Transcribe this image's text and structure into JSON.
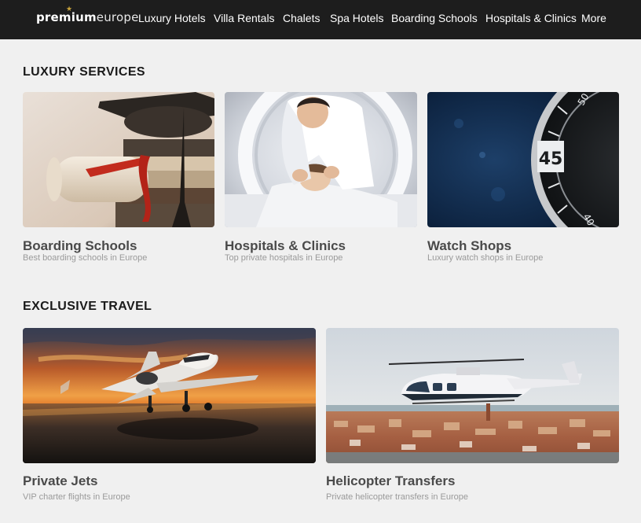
{
  "brand": {
    "logo_bold": "premium",
    "logo_light": "europe"
  },
  "nav": {
    "items": [
      {
        "label": "Luxury Hotels"
      },
      {
        "label": "Villa Rentals"
      },
      {
        "label": "Chalets"
      },
      {
        "label": "Spa Hotels"
      },
      {
        "label": "Boarding Schools"
      },
      {
        "label": "Hospitals & Clinics"
      },
      {
        "label": "More"
      }
    ]
  },
  "sections": [
    {
      "title": "LUXURY SERVICES",
      "cards": [
        {
          "title": "Boarding Schools",
          "subtitle": "Best boarding schools in Europe",
          "image": "graduation-cap-books-diploma"
        },
        {
          "title": "Hospitals & Clinics",
          "subtitle": "Top private hospitals in Europe",
          "image": "doctor-patient-mri-scanner"
        },
        {
          "title": "Watch Shops",
          "subtitle": "Luxury watch shops in Europe",
          "image": "luxury-watch-bezel"
        }
      ]
    },
    {
      "title": "EXCLUSIVE TRAVEL",
      "cards": [
        {
          "title": "Private Jets",
          "subtitle": "VIP charter flights in Europe",
          "image": "private-jet-sunset"
        },
        {
          "title": "Helicopter Transfers",
          "subtitle": "Private helicopter transfers in Europe",
          "image": "helicopter-over-venice"
        }
      ]
    }
  ],
  "image_texts": {
    "watch_numbers": [
      "45",
      "50",
      "40"
    ]
  },
  "colors": {
    "nav_bg": "#1d1d1d",
    "page_bg": "#f0f0f0",
    "logo_star": "#c9a33b",
    "card_title": "#4a4a4a",
    "card_subtitle": "#9a9a9a"
  }
}
